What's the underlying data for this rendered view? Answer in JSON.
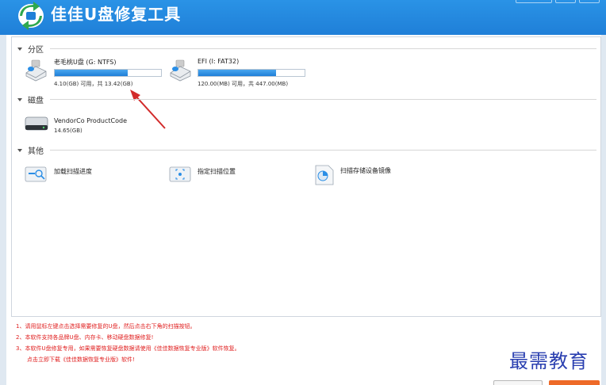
{
  "app": {
    "title": "佳佳U盘修复工具"
  },
  "sections": {
    "partition": "分区",
    "disk": "磁盘",
    "other": "其他"
  },
  "partitions": [
    {
      "name": "老毛桃U盘 (G: NTFS)",
      "info": "4.10(GB) 可用，共 13.42(GB)",
      "used_fraction": 0.69
    },
    {
      "name": "EFI (I: FAT32)",
      "info": "120.00(MB) 可用，共 447.00(MB)",
      "used_fraction": 0.73
    }
  ],
  "disks": [
    {
      "name": "VendorCo ProductCode",
      "size": "14.65(GB)"
    }
  ],
  "tools": [
    {
      "label": "加载扫描进度",
      "icon": "load-scan-progress-icon"
    },
    {
      "label": "指定扫描位置",
      "icon": "scan-location-icon"
    },
    {
      "label": "扫描存储设备镜像",
      "icon": "scan-image-icon"
    }
  ],
  "notes": [
    "1、请用鼠标左键点击选择需要修复的U盘，然后点击右下角的扫描按钮。",
    "2、本软件支持各品牌U盘、内存卡、移动硬盘数据修复!",
    "3、本软件U盘修复专用，如果需要恢复硬盘数据请使用《佳佳数据恢复专业版》软件恢复。",
    "点击立即下载《佳佳数据恢复专业版》软件!"
  ],
  "watermark": "最需教育",
  "colors": {
    "titlebar": "#1f7fd8",
    "bar_fill": "#2a8ee6",
    "notes": "#e02020",
    "accent_button": "#ee6a28",
    "arrow": "#d22b2b"
  }
}
